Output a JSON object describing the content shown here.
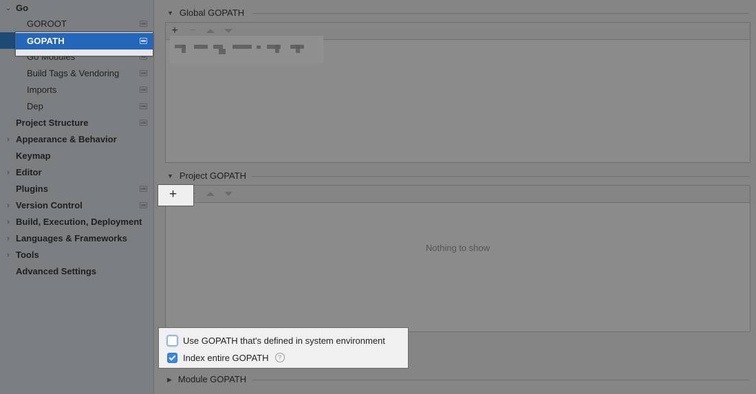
{
  "sidebar": {
    "items": [
      {
        "label": "Go",
        "level": 0,
        "expander": "expanded",
        "badge": false
      },
      {
        "label": "GOROOT",
        "level": 1,
        "expander": "none",
        "badge": true
      },
      {
        "label": "GOPATH",
        "level": 1,
        "expander": "none",
        "badge": true,
        "selected": true
      },
      {
        "label": "Go Modules",
        "level": 1,
        "expander": "none",
        "badge": true
      },
      {
        "label": "Build Tags & Vendoring",
        "level": 1,
        "expander": "none",
        "badge": true
      },
      {
        "label": "Imports",
        "level": 1,
        "expander": "none",
        "badge": true
      },
      {
        "label": "Dep",
        "level": 1,
        "expander": "none",
        "badge": true
      },
      {
        "label": "Project Structure",
        "level": 0,
        "expander": "none",
        "badge": true
      },
      {
        "label": "Appearance & Behavior",
        "level": 0,
        "expander": "collapsed",
        "badge": false
      },
      {
        "label": "Keymap",
        "level": 0,
        "expander": "none",
        "badge": false
      },
      {
        "label": "Editor",
        "level": 0,
        "expander": "collapsed",
        "badge": false
      },
      {
        "label": "Plugins",
        "level": 0,
        "expander": "none",
        "badge": true
      },
      {
        "label": "Version Control",
        "level": 0,
        "expander": "collapsed",
        "badge": true
      },
      {
        "label": "Build, Execution, Deployment",
        "level": 0,
        "expander": "collapsed",
        "badge": false
      },
      {
        "label": "Languages & Frameworks",
        "level": 0,
        "expander": "collapsed",
        "badge": false
      },
      {
        "label": "Tools",
        "level": 0,
        "expander": "collapsed",
        "badge": false
      },
      {
        "label": "Advanced Settings",
        "level": 0,
        "expander": "none",
        "badge": false
      }
    ],
    "icons": {
      "expanded": "chevron-down-icon",
      "collapsed": "chevron-right-icon",
      "badge": "project-level-icon"
    }
  },
  "main": {
    "global_gopath": {
      "title": "Global GOPATH",
      "toolbar": {
        "add": "+",
        "remove": "−",
        "move_up": "move-up-icon",
        "move_down": "move-down-icon"
      },
      "entries_note": "blurred path entry"
    },
    "project_gopath": {
      "title": "Project GOPATH",
      "toolbar": {
        "add": "+",
        "remove": "−",
        "move_up": "move-up-icon",
        "move_down": "move-down-icon"
      },
      "empty_text": "Nothing to show"
    },
    "options": {
      "use_system_gopath": {
        "label": "Use GOPATH that's defined in system environment",
        "checked": false
      },
      "index_entire_gopath": {
        "label": "Index entire GOPATH",
        "checked": true,
        "help": "?"
      }
    },
    "module_gopath": {
      "title": "Module GOPATH",
      "expanded": false
    }
  },
  "colors": {
    "selection": "#2466b9",
    "checkbox_on": "#3a86e0",
    "overlay_bg": "#858585",
    "sidebar_bg": "#7c7f82"
  }
}
